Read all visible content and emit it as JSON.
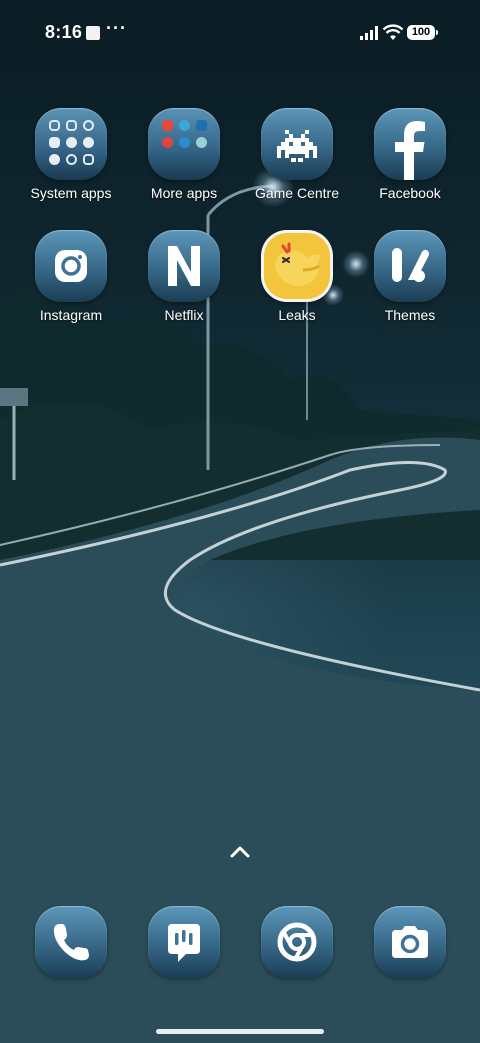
{
  "status_bar": {
    "time": "8:16",
    "overflow": "···",
    "battery": "100"
  },
  "apps": [
    {
      "label": "System apps",
      "icon": "folder-system-apps-icon"
    },
    {
      "label": "More apps",
      "icon": "folder-more-apps-icon"
    },
    {
      "label": "Game Centre",
      "icon": "space-invader-icon"
    },
    {
      "label": "Facebook",
      "icon": "facebook-f-icon"
    },
    {
      "label": "Instagram",
      "icon": "instagram-camera-icon"
    },
    {
      "label": "Netflix",
      "icon": "netflix-n-icon"
    },
    {
      "label": "Leaks",
      "icon": "yellow-bird-icon"
    },
    {
      "label": "Themes",
      "icon": "themes-brush-icon"
    }
  ],
  "dock": [
    {
      "icon": "phone-icon"
    },
    {
      "icon": "messages-icon"
    },
    {
      "icon": "chrome-icon"
    },
    {
      "icon": "camera-icon"
    }
  ],
  "colors": {
    "icon_top": "#5c97b9",
    "icon_bottom": "#1b3d55",
    "leaks_yellow": "#f2c53d"
  }
}
